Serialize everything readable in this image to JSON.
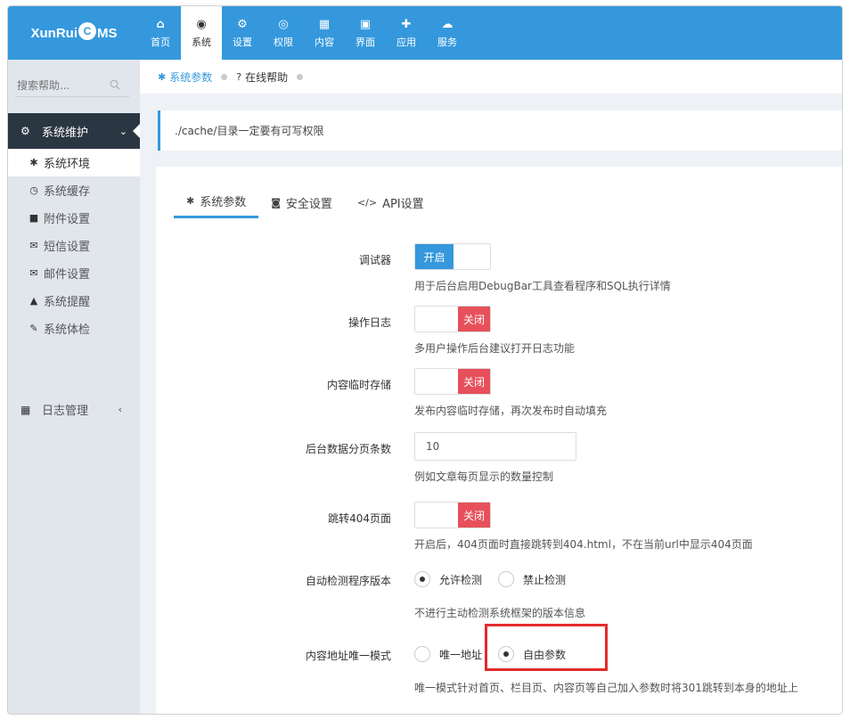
{
  "brand": {
    "logo_pre": "XunRui",
    "logo_drop": "C",
    "logo_post": "MS"
  },
  "nav": [
    {
      "label": "首页",
      "icon": "home-icon",
      "glyph": "⌂"
    },
    {
      "label": "系统",
      "icon": "globe-icon",
      "glyph": "◉",
      "active": true
    },
    {
      "label": "设置",
      "icon": "gears-icon",
      "glyph": "⚙"
    },
    {
      "label": "权限",
      "icon": "user-circle-icon",
      "glyph": "◎"
    },
    {
      "label": "内容",
      "icon": "grid-icon",
      "glyph": "▦"
    },
    {
      "label": "界面",
      "icon": "html5-icon",
      "glyph": "▣"
    },
    {
      "label": "应用",
      "icon": "puzzle-icon",
      "glyph": "✚"
    },
    {
      "label": "服务",
      "icon": "cloud-icon",
      "glyph": "☁"
    }
  ],
  "sidebar": {
    "search_placeholder": "搜索帮助...",
    "group": {
      "label": "系统维护",
      "icon": "gear-icon",
      "glyph": "⚙"
    },
    "items": [
      {
        "label": "系统环境",
        "icon": "gear-icon",
        "glyph": "✱",
        "active": true
      },
      {
        "label": "系统缓存",
        "icon": "clock-icon",
        "glyph": "◷"
      },
      {
        "label": "附件设置",
        "icon": "folder-icon",
        "glyph": "■"
      },
      {
        "label": "短信设置",
        "icon": "envelope-icon",
        "glyph": "✉"
      },
      {
        "label": "邮件设置",
        "icon": "envelope-open-icon",
        "glyph": "✉"
      },
      {
        "label": "系统提醒",
        "icon": "bell-icon",
        "glyph": "▲"
      },
      {
        "label": "系统体检",
        "icon": "wrench-icon",
        "glyph": "✎"
      }
    ],
    "group2": {
      "label": "日志管理",
      "icon": "calendar-icon",
      "glyph": "▦"
    }
  },
  "breadcrumb": [
    {
      "label": "系统参数",
      "icon": "gear-icon",
      "glyph": "✱",
      "active": true
    },
    {
      "label": "在线帮助",
      "icon": "question-icon",
      "glyph": "?"
    }
  ],
  "notice": "./cache/目录一定要有可写权限",
  "tabs": [
    {
      "label": "系统参数",
      "icon": "gear-icon",
      "glyph": "✱",
      "active": true
    },
    {
      "label": "安全设置",
      "icon": "lock-icon",
      "glyph": "◙"
    },
    {
      "label": "API设置",
      "icon": "code-icon",
      "glyph": "</>"
    }
  ],
  "form": {
    "debugger": {
      "label": "调试器",
      "state_label": "开启",
      "help": "用于后台启用DebugBar工具查看程序和SQL执行详情"
    },
    "oplog": {
      "label": "操作日志",
      "state_label": "关闭",
      "help": "多用户操作后台建议打开日志功能"
    },
    "tempsave": {
      "label": "内容临时存储",
      "state_label": "关闭",
      "help": "发布内容临时存储，再次发布时自动填充"
    },
    "pagesize": {
      "label": "后台数据分页条数",
      "value": "10",
      "help": "例如文章每页显示的数量控制"
    },
    "jump404": {
      "label": "跳转404页面",
      "state_label": "关闭",
      "help": "开启后，404页面时直接跳转到404.html，不在当前url中显示404页面"
    },
    "version_check": {
      "label": "自动检测程序版本",
      "options": [
        "允许检测",
        "禁止检测"
      ],
      "selected": 0,
      "help": "不进行主动检测系统框架的版本信息"
    },
    "url_mode": {
      "label": "内容地址唯一模式",
      "options": [
        "唯一地址",
        "自由参数"
      ],
      "selected": 1,
      "help": "唯一模式针对首页、栏目页、内容页等自己加入参数时将301跳转到本身的地址上"
    }
  },
  "colors": {
    "primary": "#3598dc",
    "danger": "#e7505a",
    "sidebar_dark": "#2b3643",
    "highlight": "#e32b2b"
  }
}
